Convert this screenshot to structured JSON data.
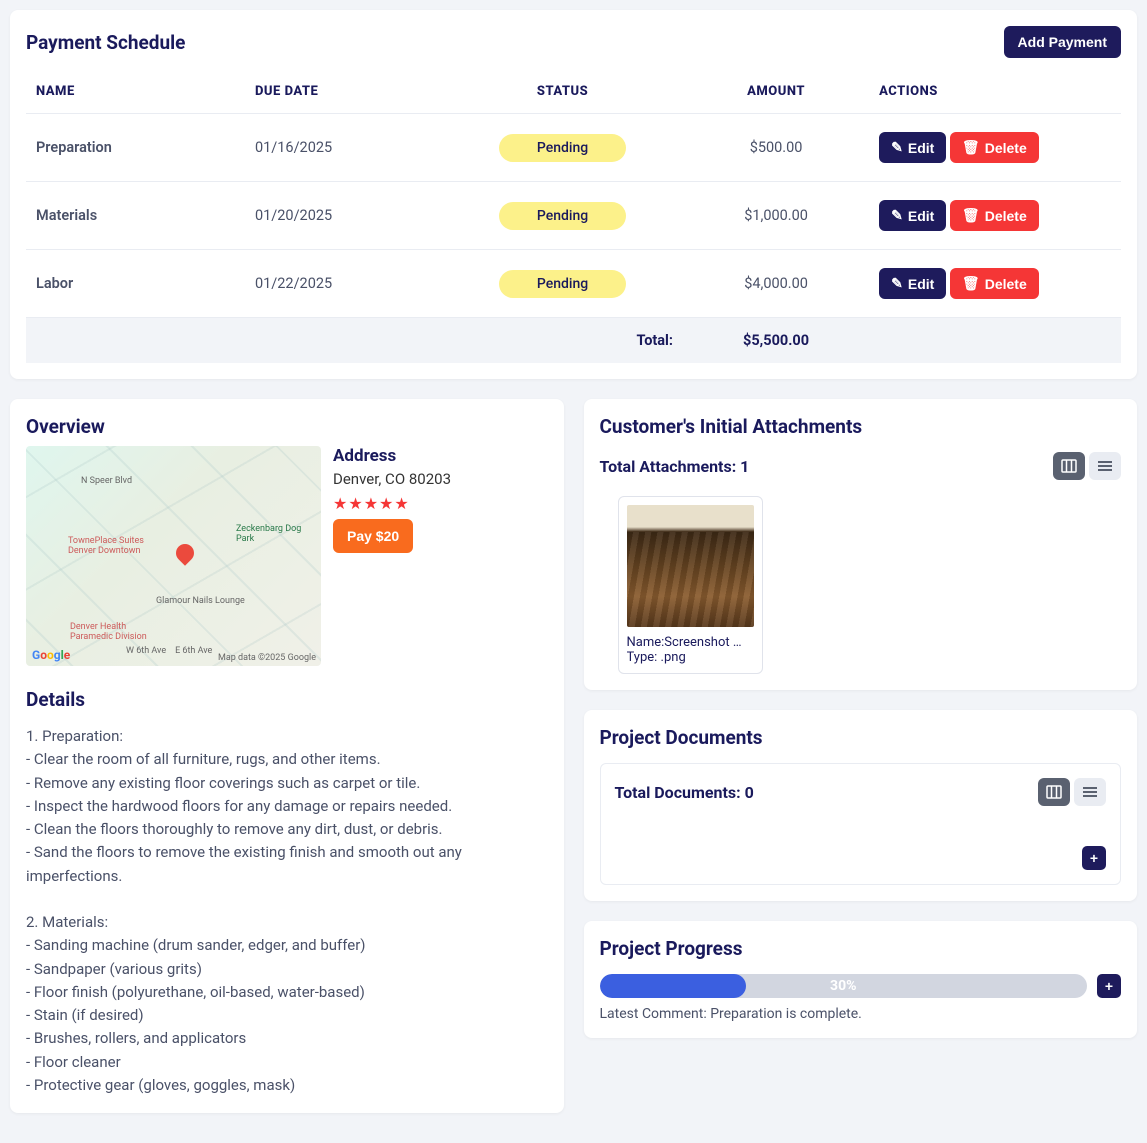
{
  "schedule": {
    "title": "Payment Schedule",
    "add_label": "Add Payment",
    "headers": {
      "name": "NAME",
      "due": "DUE DATE",
      "status": "STATUS",
      "amount": "AMOUNT",
      "actions": "ACTIONS"
    },
    "rows": [
      {
        "name": "Preparation",
        "due": "01/16/2025",
        "status": "Pending",
        "amount": "$500.00"
      },
      {
        "name": "Materials",
        "due": "01/20/2025",
        "status": "Pending",
        "amount": "$1,000.00"
      },
      {
        "name": "Labor",
        "due": "01/22/2025",
        "status": "Pending",
        "amount": "$4,000.00"
      }
    ],
    "total_label": "Total:",
    "total_value": "$5,500.00",
    "edit_label": "Edit",
    "delete_label": "Delete"
  },
  "overview": {
    "title": "Overview",
    "address_title": "Address",
    "address_text": "Denver, CO 80203",
    "stars": "★★★★★",
    "pay_label": "Pay $20",
    "map_attr": "Map data ©2025 Google",
    "details_title": "Details",
    "details_body": "1. Preparation:\n- Clear the room of all furniture, rugs, and other items.\n- Remove any existing floor coverings such as carpet or tile.\n- Inspect the hardwood floors for any damage or repairs needed.\n- Clean the floors thoroughly to remove any dirt, dust, or debris.\n- Sand the floors to remove the existing finish and smooth out any imperfections.\n\n2. Materials:\n- Sanding machine (drum sander, edger, and buffer)\n- Sandpaper (various grits)\n- Floor finish (polyurethane, oil-based, water-based)\n- Stain (if desired)\n- Brushes, rollers, and applicators\n- Floor cleaner\n- Protective gear (gloves, goggles, mask)"
  },
  "attachments": {
    "title": "Customer's Initial Attachments",
    "total_label": "Total Attachments: 1",
    "item": {
      "name_label": "Name:",
      "name_value": "Screenshot …",
      "type_label": "Type: ",
      "type_value": ".png"
    }
  },
  "documents": {
    "title": "Project Documents",
    "total_label": "Total Documents: 0",
    "add_label": "+"
  },
  "progress": {
    "title": "Project Progress",
    "percent_text": "30%",
    "percent_value": 30,
    "comment": "Latest Comment: Preparation is complete.",
    "add_label": "+"
  }
}
